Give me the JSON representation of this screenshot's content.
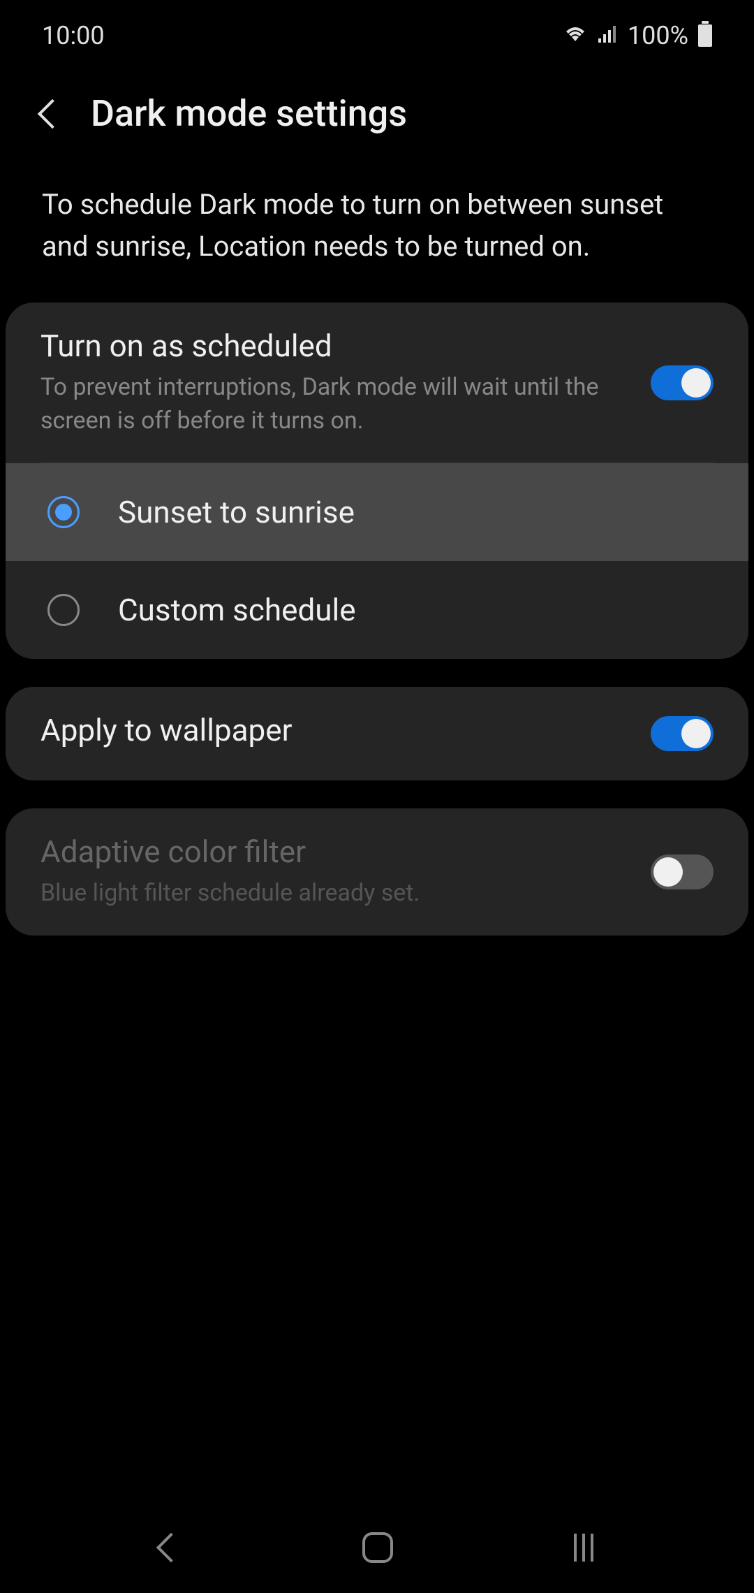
{
  "status_bar": {
    "time": "10:00",
    "battery": "100%"
  },
  "header": {
    "title": "Dark mode settings"
  },
  "info_text": "To schedule Dark mode to turn on between sunset and sunrise, Location needs to be turned on.",
  "schedule_card": {
    "title": "Turn on as scheduled",
    "subtitle": "To prevent interruptions, Dark mode will wait until the screen is off before it turns on.",
    "toggle_on": true,
    "options": [
      {
        "label": "Sunset to sunrise",
        "selected": true
      },
      {
        "label": "Custom schedule",
        "selected": false
      }
    ]
  },
  "wallpaper_card": {
    "title": "Apply to wallpaper",
    "toggle_on": true
  },
  "adaptive_card": {
    "title": "Adaptive color filter",
    "subtitle": "Blue light filter schedule already set.",
    "toggle_on": false,
    "disabled": true
  }
}
